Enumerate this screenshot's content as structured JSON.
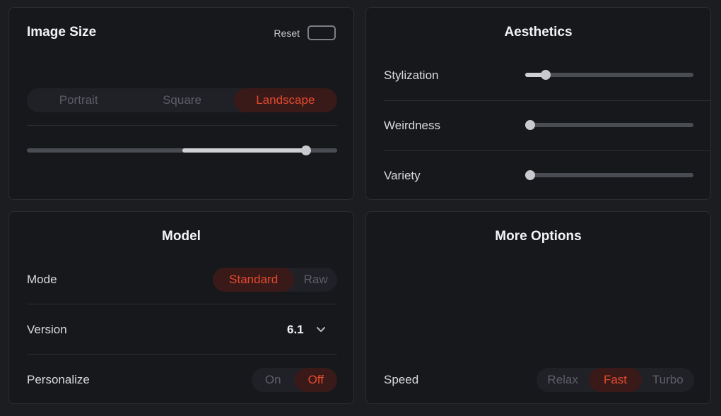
{
  "image_size": {
    "title": "Image Size",
    "reset_label": "Reset",
    "aspect_options": [
      "Portrait",
      "Square",
      "Landscape"
    ],
    "aspect_selected": "Landscape",
    "ratio_slider": {
      "range_start": 0.5,
      "value": 0.9
    }
  },
  "aesthetics": {
    "title": "Aesthetics",
    "sliders": [
      {
        "label": "Stylization",
        "value": 0.1
      },
      {
        "label": "Weirdness",
        "value": 0.0
      },
      {
        "label": "Variety",
        "value": 0.0
      }
    ]
  },
  "model": {
    "title": "Model",
    "mode_label": "Mode",
    "mode_options": [
      "Standard",
      "Raw"
    ],
    "mode_selected": "Standard",
    "version_label": "Version",
    "version_value": "6.1",
    "personalize_label": "Personalize",
    "personalize_options": [
      "On",
      "Off"
    ],
    "personalize_selected": "Off"
  },
  "more_options": {
    "title": "More Options",
    "speed_label": "Speed",
    "speed_options": [
      "Relax",
      "Fast",
      "Turbo"
    ],
    "speed_selected": "Fast"
  },
  "colors": {
    "accent": "#e24a2f",
    "active_bg": "#3a1a18",
    "panel_bg": "#17181c",
    "page_bg": "#1c1d21"
  },
  "icons": {
    "version_dropdown": "chevron-down-icon"
  }
}
